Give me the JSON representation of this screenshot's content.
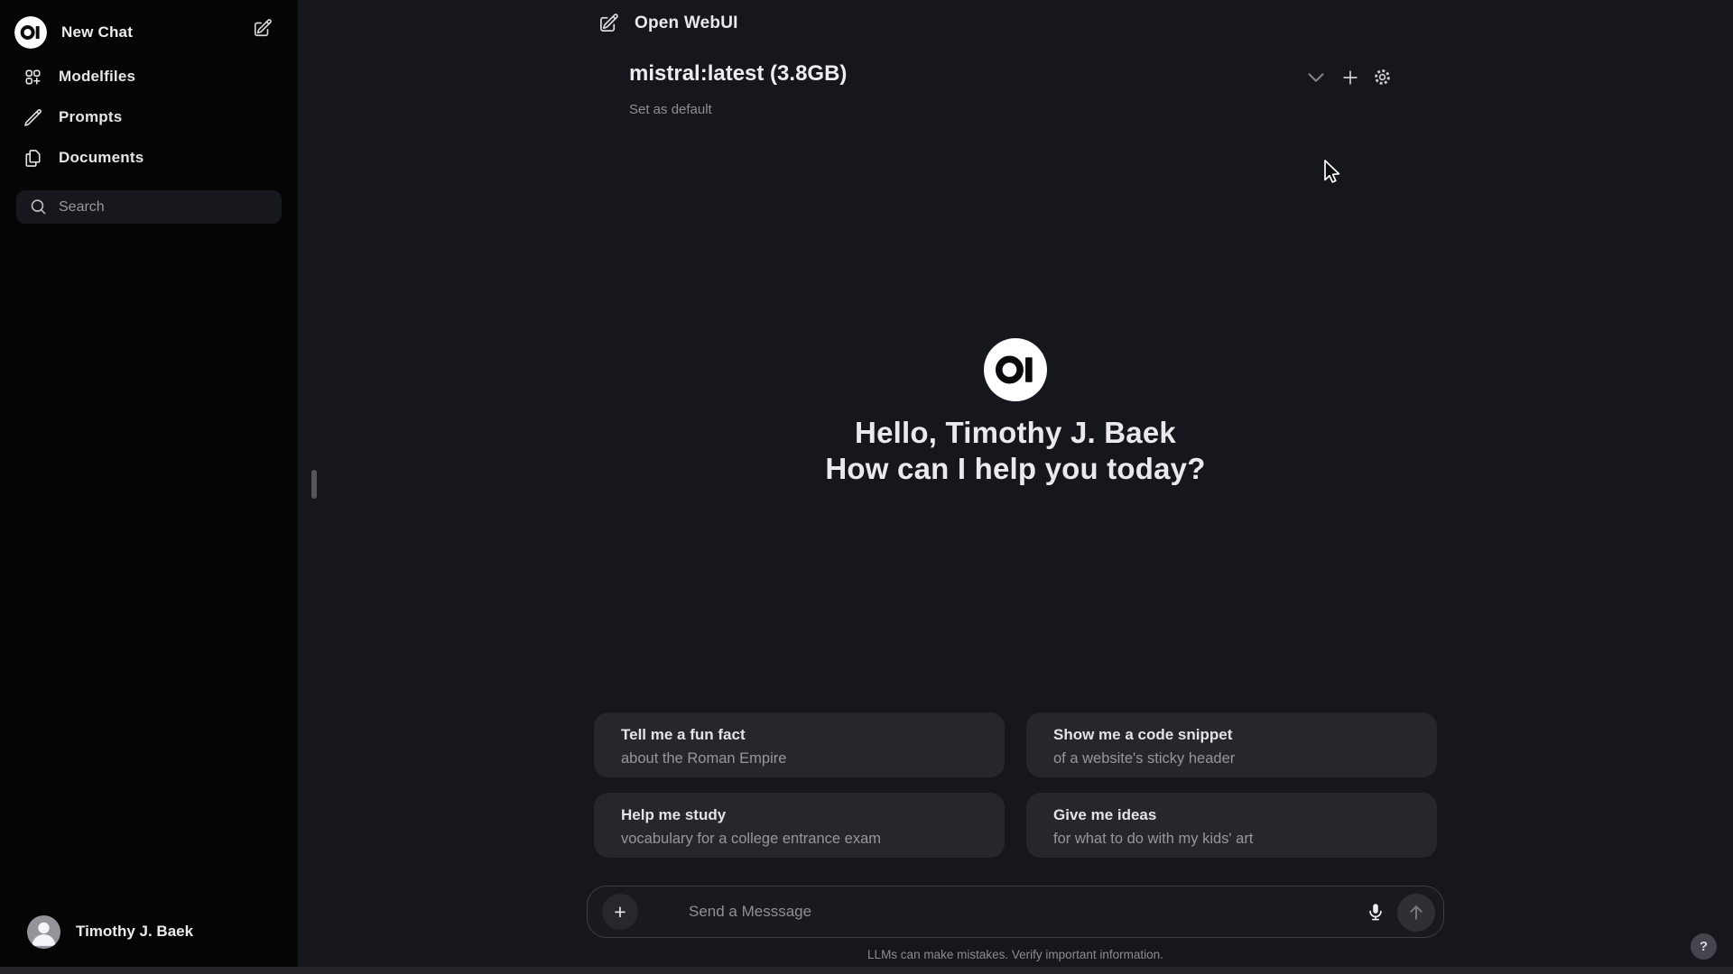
{
  "app": {
    "name": "Open WebUI",
    "help_label": "?"
  },
  "sidebar": {
    "new_chat_label": "New Chat",
    "items": [
      {
        "label": "Modelfiles",
        "icon": "squares-plus-icon"
      },
      {
        "label": "Prompts",
        "icon": "pencil-icon"
      },
      {
        "label": "Documents",
        "icon": "document-duplicate-icon"
      }
    ],
    "search_placeholder": "Search",
    "user_name": "Timothy J. Baek"
  },
  "model_bar": {
    "model": "mistral:latest (3.8GB)",
    "set_default_label": "Set as default",
    "actions": [
      "chevron-down-icon",
      "plus-icon",
      "gear-icon"
    ]
  },
  "greeting": {
    "line1": "Hello, Timothy J. Baek",
    "line2": "How can I help you today?"
  },
  "suggestions": [
    {
      "title": "Tell me a fun fact",
      "subtitle": "about the Roman Empire"
    },
    {
      "title": "Show me a code snippet",
      "subtitle": "of a website's sticky header"
    },
    {
      "title": "Help me study",
      "subtitle": "vocabulary for a college entrance exam"
    },
    {
      "title": "Give me ideas",
      "subtitle": "for what to do with my kids' art"
    }
  ],
  "composer": {
    "placeholder": "Send a Messsage",
    "plus_label": "+"
  },
  "footer": {
    "disclaimer": "LLMs can make mistakes. Verify important information."
  },
  "colors": {
    "sidebar_bg": "#050505",
    "main_bg": "#16171c",
    "card_bg": "#26272d",
    "primary_text": "#ececee",
    "secondary_text": "#96969b"
  }
}
